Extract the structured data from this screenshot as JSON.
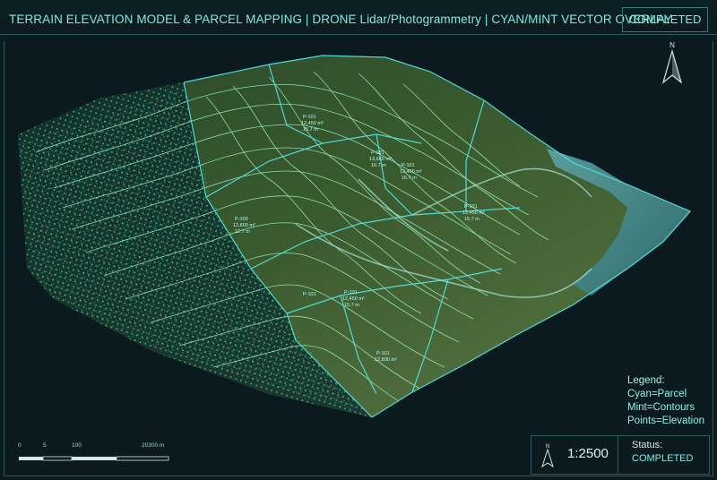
{
  "header": {
    "title": "TERRAIN ELEVATION MODEL & PARCEL MAPPING | DRONE Lidar/Photogrammetry | CYAN/MINT VECTOR OVERLAY",
    "status_badge": "COMPLETED"
  },
  "compass": {
    "letter": "N",
    "icon": "north-arrow-icon"
  },
  "parcels": [
    {
      "id": "P-101",
      "area": "12,450 m²",
      "elev": "15.7 m"
    },
    {
      "id": "P-101",
      "area": "13,660 m²",
      "elev": "16.7 m"
    },
    {
      "id": "P-101",
      "area": "12,450 m²",
      "elev": "15.7 m"
    },
    {
      "id": "P-100",
      "area": "12,800 m²",
      "elev": "12.7 m"
    },
    {
      "id": "P-101",
      "area": "12,450 m²",
      "elev": "15.7 m"
    },
    {
      "id": "P-101",
      "area": "12,450 m²",
      "elev": "15.7 m"
    },
    {
      "id": "P-101",
      "area": "",
      "elev": ""
    },
    {
      "id": "P-101",
      "area": "12,800 m²",
      "elev": ""
    }
  ],
  "legend": {
    "heading": "Legend:",
    "items": [
      "Cyan=Parcel",
      "Mint=Contours",
      "Points=Elevation"
    ],
    "colors": {
      "parcel": "#4fe3e0",
      "contours": "#9df5c8",
      "points": "#3ee8c8"
    }
  },
  "scale_bar": {
    "labels": [
      "0",
      "5",
      "100",
      "20300 m"
    ]
  },
  "bottom_panel": {
    "north_letter": "N",
    "scale": "1:2500",
    "status_label": "Status:",
    "status_value": "COMPLETED"
  },
  "colors": {
    "background": "#0b1a1f",
    "accent": "#7fe9e0",
    "terrain_dark": "#1e3a24",
    "water": "#3d7f86"
  }
}
